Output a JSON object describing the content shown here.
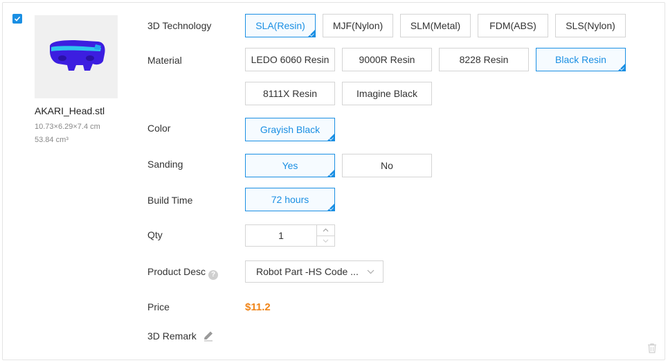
{
  "item": {
    "selected": true,
    "file_name": "AKARI_Head.stl",
    "dimensions": "10.73×6.29×7.4 cm",
    "volume": "53.84 cm³"
  },
  "technology": {
    "label": "3D Technology",
    "options": [
      "SLA(Resin)",
      "MJF(Nylon)",
      "SLM(Metal)",
      "FDM(ABS)",
      "SLS(Nylon)"
    ],
    "selected": "SLA(Resin)"
  },
  "material": {
    "label": "Material",
    "options": [
      "LEDO 6060 Resin",
      "9000R Resin",
      "8228 Resin",
      "Black Resin",
      "8111X Resin",
      "Imagine Black"
    ],
    "selected": "Black Resin"
  },
  "color": {
    "label": "Color",
    "options": [
      "Grayish Black"
    ],
    "selected": "Grayish Black"
  },
  "sanding": {
    "label": "Sanding",
    "options": [
      "Yes",
      "No"
    ],
    "selected": "Yes"
  },
  "build_time": {
    "label": "Build Time",
    "options": [
      "72 hours"
    ],
    "selected": "72 hours"
  },
  "qty": {
    "label": "Qty",
    "value": "1"
  },
  "product_desc": {
    "label": "Product Desc",
    "value": "Robot Part -HS Code ..."
  },
  "price": {
    "label": "Price",
    "value": "$11.2"
  },
  "remark": {
    "label": "3D Remark"
  },
  "colors": {
    "accent": "#1a8fe3",
    "price": "#f08519",
    "model": "#3c1ee0"
  },
  "icons": [
    "check-icon",
    "model-preview",
    "help-icon",
    "chevron-down-icon",
    "caret-up-icon",
    "caret-down-icon",
    "pencil-icon",
    "trash-icon"
  ]
}
